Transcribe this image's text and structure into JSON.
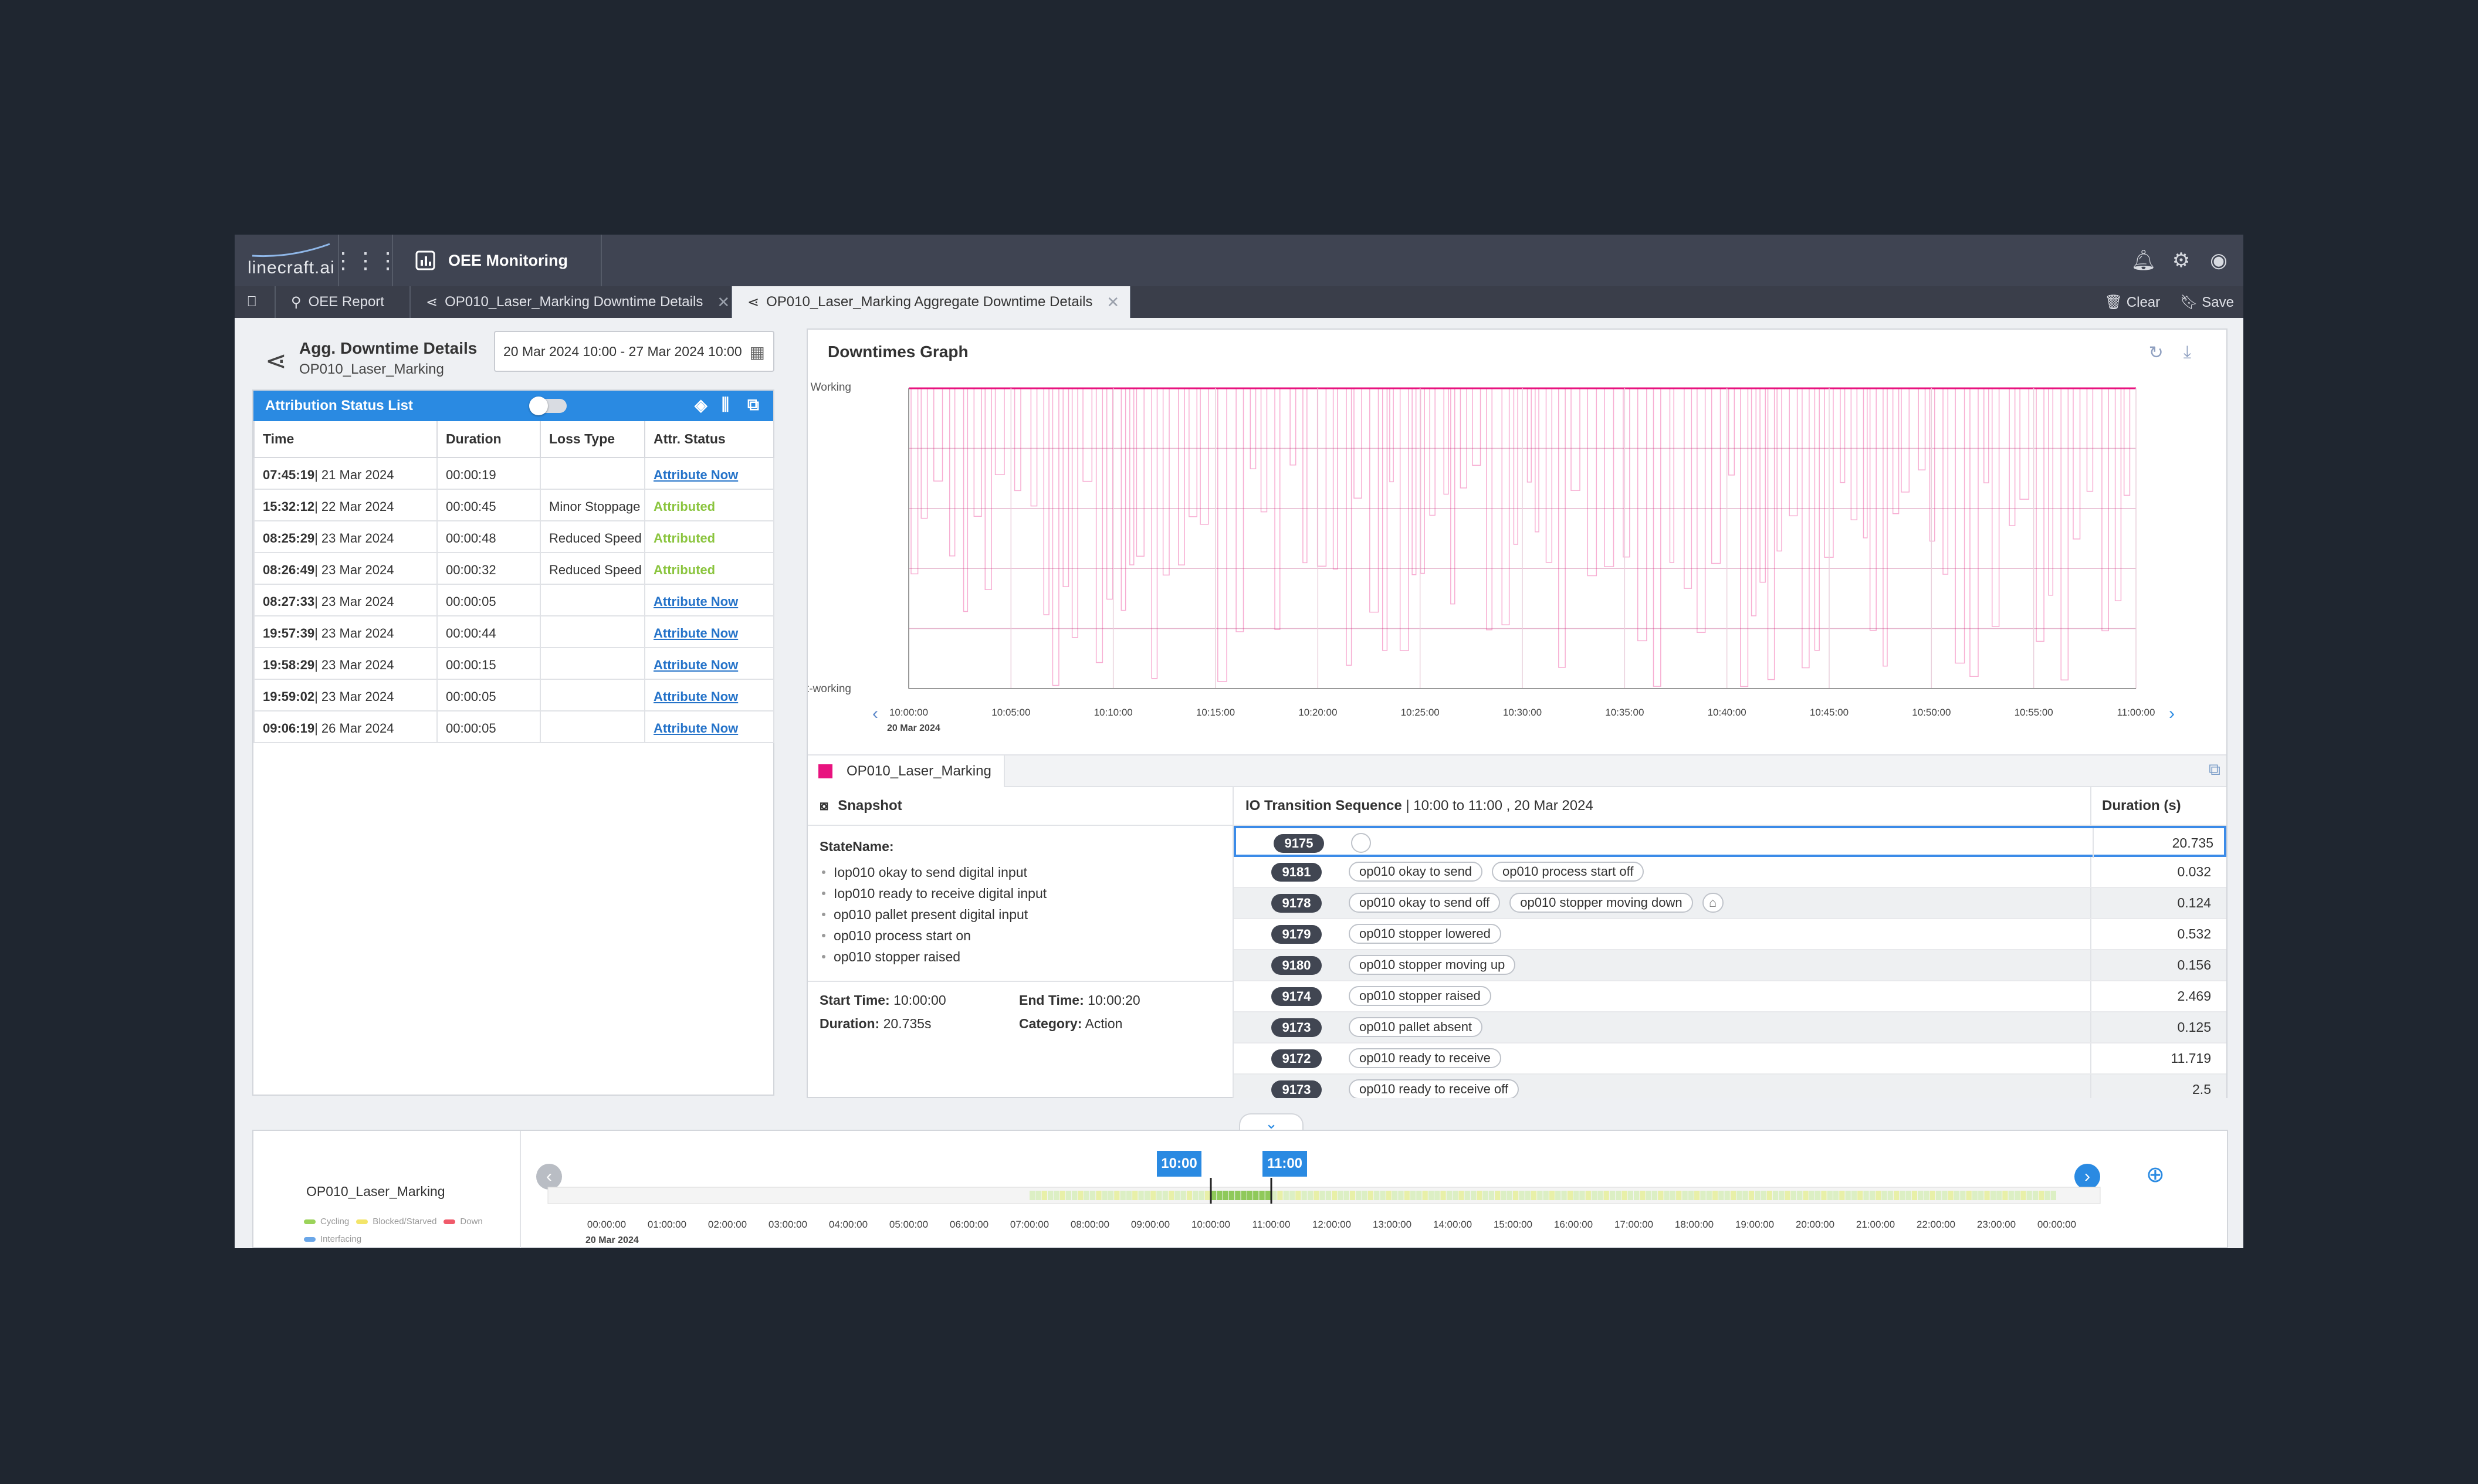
{
  "app": {
    "logo_text": "linecraft.ai",
    "module_title": "OEE Monitoring"
  },
  "tabs": [
    {
      "label": "OEE Report"
    },
    {
      "label": "OP010_Laser_Marking Downtime Details"
    },
    {
      "label": "OP010_Laser_Marking Aggregate Downtime Details"
    }
  ],
  "tab_actions": {
    "clear": "Clear",
    "save": "Save"
  },
  "header": {
    "title": "Agg. Downtime Details",
    "subtitle": "OP010_Laser_Marking",
    "date_range": "20 Mar 2024 10:00 - 27 Mar 2024 10:00"
  },
  "attribution": {
    "title": "Attribution Status List",
    "columns": [
      "Time",
      "Duration",
      "Loss Type",
      "Attr. Status"
    ],
    "rows": [
      {
        "time": "07:45:19",
        "date": "| 21 Mar 2024",
        "duration": "00:00:19",
        "loss": "",
        "status": "Attribute Now"
      },
      {
        "time": "15:32:12",
        "date": "| 22 Mar 2024",
        "duration": "00:00:45",
        "loss": "Minor Stoppage",
        "status": "Attributed"
      },
      {
        "time": "08:25:29",
        "date": "| 23 Mar 2024",
        "duration": "00:00:48",
        "loss": "Reduced Speed",
        "status": "Attributed"
      },
      {
        "time": "08:26:49",
        "date": "| 23 Mar 2024",
        "duration": "00:00:32",
        "loss": "Reduced Speed",
        "status": "Attributed"
      },
      {
        "time": "08:27:33",
        "date": "| 23 Mar 2024",
        "duration": "00:00:05",
        "loss": "",
        "status": "Attribute Now"
      },
      {
        "time": "19:57:39",
        "date": "| 23 Mar 2024",
        "duration": "00:00:44",
        "loss": "",
        "status": "Attribute Now"
      },
      {
        "time": "19:58:29",
        "date": "| 23 Mar 2024",
        "duration": "00:00:15",
        "loss": "",
        "status": "Attribute Now"
      },
      {
        "time": "19:59:02",
        "date": "| 23 Mar 2024",
        "duration": "00:00:05",
        "loss": "",
        "status": "Attribute Now"
      },
      {
        "time": "09:06:19",
        "date": "| 26 Mar 2024",
        "duration": "00:00:05",
        "loss": "",
        "status": "Attribute Now"
      }
    ]
  },
  "graph": {
    "title": "Downtimes Graph",
    "y_top": "Working",
    "y_bottom": "Not-working",
    "x_ticks": [
      "10:00:00",
      "10:05:00",
      "10:10:00",
      "10:15:00",
      "10:20:00",
      "10:25:00",
      "10:30:00",
      "10:35:00",
      "10:40:00",
      "10:45:00",
      "10:50:00",
      "10:55:00",
      "11:00:00"
    ],
    "x_date": "20 Mar 2024",
    "series_color": "#e8137f"
  },
  "station_tab": "OP010_Laser_Marking",
  "snapshot": {
    "title": "Snapshot",
    "state_label": "StateName:",
    "states": [
      "Iop010 okay to send digital input",
      "Iop010 ready to receive digital input",
      "op010 pallet present digital input",
      "op010 process start on",
      "op010 stopper raised"
    ],
    "start_label": "Start Time:",
    "start": "10:00:00",
    "end_label": "End Time:",
    "end": "10:00:20",
    "duration_label": "Duration:",
    "duration": "20.735s",
    "category_label": "Category:",
    "category": "Action"
  },
  "sequence": {
    "title": "IO Transition Sequence",
    "range": "| 10:00 to 11:00 , 20 Mar 2024",
    "duration_header": "Duration (s)",
    "rows": [
      {
        "id": "9175",
        "chips": [],
        "duration": "20.735"
      },
      {
        "id": "9181",
        "chips": [
          "op010 okay to send",
          "op010 process start off"
        ],
        "duration": "0.032"
      },
      {
        "id": "9178",
        "chips": [
          "op010 okay to send off",
          "op010 stopper moving down"
        ],
        "duration": "0.124"
      },
      {
        "id": "9179",
        "chips": [
          "op010 stopper lowered"
        ],
        "duration": "0.532"
      },
      {
        "id": "9180",
        "chips": [
          "op010 stopper moving up"
        ],
        "duration": "0.156"
      },
      {
        "id": "9174",
        "chips": [
          "op010 stopper raised"
        ],
        "duration": "2.469"
      },
      {
        "id": "9173",
        "chips": [
          "op010 pallet absent"
        ],
        "duration": "0.125"
      },
      {
        "id": "9172",
        "chips": [
          "op010 ready to receive"
        ],
        "duration": "11.719"
      },
      {
        "id": "9173",
        "chips": [
          "op010 ready to receive off"
        ],
        "duration": "2.5"
      }
    ]
  },
  "timeline": {
    "station": "OP010_Laser_Marking",
    "legend": [
      {
        "label": "Cycling",
        "color": "#9bd35a"
      },
      {
        "label": "Blocked/Starved",
        "color": "#f3e56a"
      },
      {
        "label": "Down",
        "color": "#f05a6a"
      },
      {
        "label": "Interfacing",
        "color": "#6aa6e8"
      }
    ],
    "marker_start": "10:00",
    "marker_end": "11:00",
    "ticks": [
      "00:00:00",
      "01:00:00",
      "02:00:00",
      "03:00:00",
      "04:00:00",
      "05:00:00",
      "06:00:00",
      "07:00:00",
      "08:00:00",
      "09:00:00",
      "10:00:00",
      "11:00:00",
      "12:00:00",
      "13:00:00",
      "14:00:00",
      "15:00:00",
      "16:00:00",
      "17:00:00",
      "18:00:00",
      "19:00:00",
      "20:00:00",
      "21:00:00",
      "22:00:00",
      "23:00:00",
      "00:00:00"
    ],
    "date": "20 Mar 2024"
  }
}
